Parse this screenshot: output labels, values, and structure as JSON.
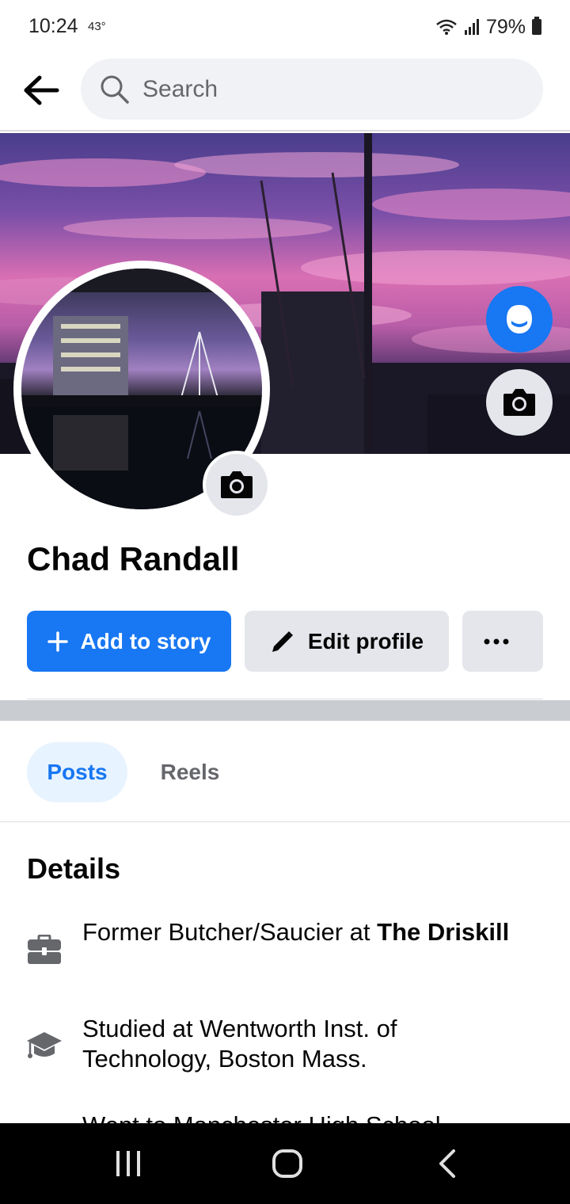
{
  "status": {
    "time": "10:24",
    "temp": "43°",
    "battery": "79%"
  },
  "search": {
    "placeholder": "Search"
  },
  "profile": {
    "name": "Chad Randall"
  },
  "actions": {
    "add_story": "Add to story",
    "edit_profile": "Edit profile"
  },
  "tabs": [
    {
      "label": "Posts",
      "selected": true
    },
    {
      "label": "Reels",
      "selected": false
    }
  ],
  "details": {
    "title": "Details",
    "items": [
      {
        "prefix": "Former Butcher/Saucier at ",
        "bold": "The Driskill",
        "icon": "briefcase-icon"
      },
      {
        "prefix": "Studied at Wentworth Inst. of Technology, Boston Mass.",
        "bold": "",
        "icon": "graduation-cap-icon"
      },
      {
        "prefix": "Went to Manchester High School",
        "bold": "",
        "icon": "graduation-cap-icon"
      }
    ]
  },
  "colors": {
    "accent": "#1877f2",
    "button_gray": "#e4e6eb",
    "tab_selected_bg": "#e7f3ff"
  }
}
